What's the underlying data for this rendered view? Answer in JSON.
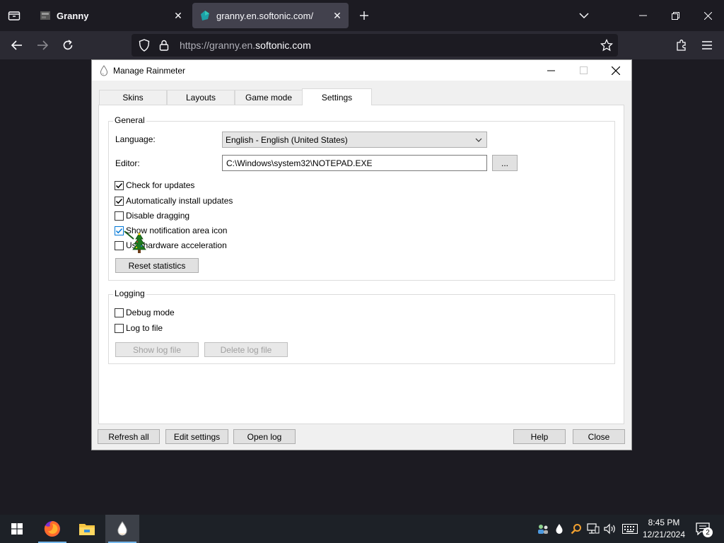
{
  "browser": {
    "tabs": [
      {
        "title": "Granny",
        "active": false
      },
      {
        "title": "granny.en.softonic.com/",
        "active": true
      }
    ],
    "url": {
      "scheme": "https://",
      "host_prefix": "granny.en.",
      "host_main": "softonic.com"
    }
  },
  "dialog": {
    "title": "Manage Rainmeter",
    "tabs": [
      "Skins",
      "Layouts",
      "Game mode",
      "Settings"
    ],
    "general": {
      "label": "General",
      "language_label": "Language:",
      "language_value": "English - English (United States)",
      "editor_label": "Editor:",
      "editor_value": "C:\\Windows\\system32\\NOTEPAD.EXE",
      "browse_label": "...",
      "checks": [
        {
          "label": "Check for updates",
          "checked": true
        },
        {
          "label": "Automatically install updates",
          "checked": true
        },
        {
          "label": "Disable dragging",
          "checked": false
        },
        {
          "label": "Show notification area icon",
          "checked": true
        },
        {
          "label": "Use hardware acceleration",
          "checked": false
        }
      ],
      "reset_label": "Reset statistics"
    },
    "logging": {
      "label": "Logging",
      "checks": [
        {
          "label": "Debug mode",
          "checked": false
        },
        {
          "label": "Log to file",
          "checked": false
        }
      ],
      "show_log_label": "Show log file",
      "delete_log_label": "Delete log file"
    },
    "buttons": {
      "refresh": "Refresh all",
      "edit": "Edit settings",
      "open_log": "Open log",
      "help": "Help",
      "close": "Close"
    }
  },
  "taskbar": {
    "apps": [
      "firefox-icon",
      "file-explorer-icon",
      "rainmeter-icon"
    ],
    "time": "8:45 PM",
    "date": "12/21/2024",
    "notification_count": "2"
  },
  "colors": {
    "accent": "#0078d7",
    "browser_bg": "#1c1b22",
    "taskbar": "#1d2127"
  }
}
